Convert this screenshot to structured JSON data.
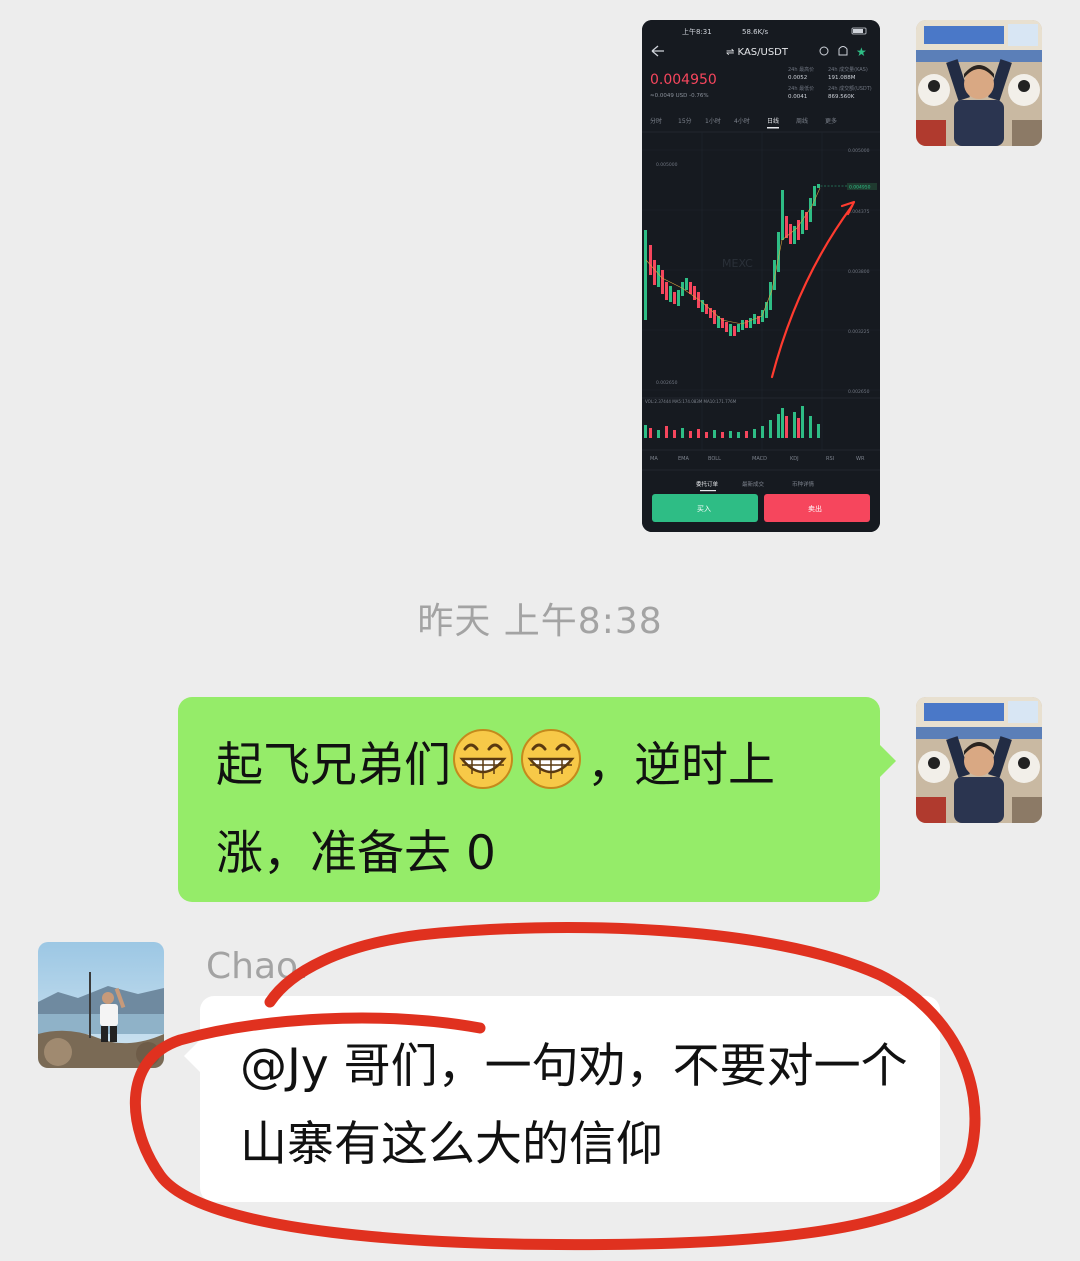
{
  "messages": {
    "image": {
      "status_bar": "上午8:31",
      "net_speed": "58.6K/s",
      "pair": "⇌ KAS/USDT",
      "price": "0.004950",
      "change": "≈0.0049 USD  -0.76%",
      "high_label": "24h 最高价",
      "high_value": "0.0052",
      "vol_label": "24h 成交量(KAS)",
      "vol_value": "191.088M",
      "low_label": "24h 最低价",
      "low_value": "0.0041",
      "turnover_label": "24h 成交额(USDT)",
      "turnover_value": "869.560K",
      "tabs": [
        "分时",
        "15分",
        "1小时",
        "4小时",
        "日线",
        "周线",
        "更多"
      ],
      "price_tags": [
        "0.005000",
        "0.004950",
        "0.004375",
        "0.003800",
        "0.003225",
        "0.002650"
      ],
      "chart_low_label": "0.002650",
      "watermark": "MEXC",
      "vol_line": "VOL:2.37444   MA5:174.083M   MA10:171.776M",
      "indicators": [
        "MA",
        "EMA",
        "BOLL",
        "MACD",
        "KDJ",
        "RSI",
        "WR"
      ],
      "subtabs": [
        "委托订单",
        "最新成交",
        "币种详情"
      ],
      "buy_label": "买入",
      "sell_label": "卖出",
      "accent_green": "#2ebd85",
      "accent_red": "#f6465d"
    },
    "timestamp": "昨天 上午8:38",
    "own_text_a": "起飞兄弟们",
    "own_text_b": "，逆时上涨，准备去 0",
    "own_emoji": "grinning-face-emoji",
    "sender": "Chao.",
    "incoming_text": "@Jy  哥们，一句劝，不要对一个山寨有这么大的信仰",
    "bubble_green_color": "#95ec69",
    "annotation_color": "#e0311f"
  }
}
